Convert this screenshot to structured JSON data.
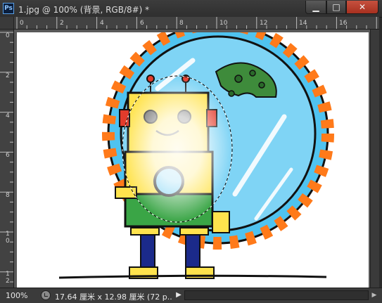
{
  "window": {
    "app_icon_text": "Ps",
    "document_title": "1.jpg @ 100% (背景, RGB/8#) *",
    "minimize_icon": "minimize-icon",
    "maximize_icon": "maximize-icon",
    "close_icon": "close-icon"
  },
  "rulers": {
    "horizontal_labels": [
      "0",
      "2",
      "4",
      "6",
      "8",
      "10",
      "12",
      "14",
      "16"
    ],
    "vertical_labels": [
      "0",
      "2",
      "4",
      "6",
      "8",
      "1\n0",
      "1\n2"
    ]
  },
  "document": {
    "content": "illustration of a cartoon robot standing in front of a round porthole window, with an elliptical marquee selection"
  },
  "statusbar": {
    "zoom": "100%",
    "doc_info": "17.64 厘米 x 12.98 厘米 (72 p...",
    "menu_arrow": "▶"
  }
}
